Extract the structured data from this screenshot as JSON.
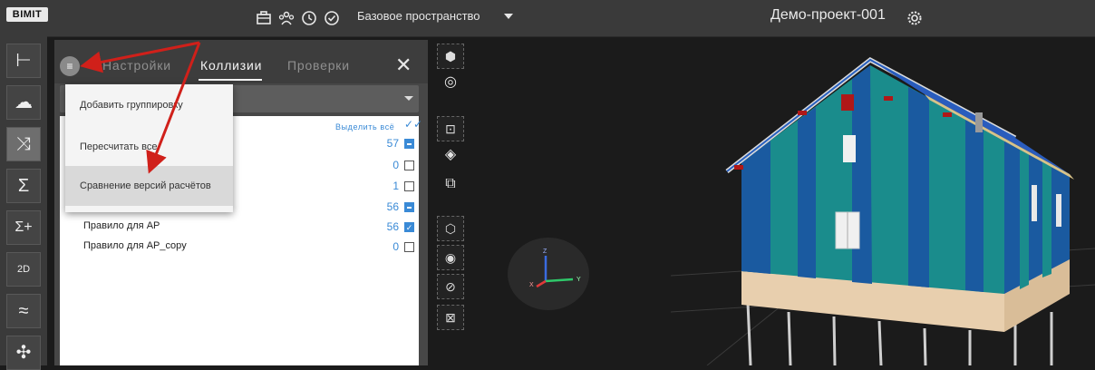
{
  "app": {
    "logo": "BIMIT"
  },
  "topbar": {
    "space_label": "Базовое пространство",
    "project_name": "Демо-проект-001",
    "icons": [
      "briefcase-icon",
      "users-icon",
      "clock-icon",
      "check-circle-icon",
      "settings-gear-icon"
    ]
  },
  "sidebar": {
    "items": [
      {
        "icon": "tree-icon",
        "glyph": "⊢"
      },
      {
        "icon": "cloud-sync-icon",
        "glyph": "☁"
      },
      {
        "icon": "shuffle-icon",
        "glyph": "⤨"
      },
      {
        "icon": "sigma-icon",
        "glyph": "Σ"
      },
      {
        "icon": "sigma-plus-icon",
        "glyph": "Σ+"
      },
      {
        "icon": "drawing-2d-icon",
        "glyph": "2D"
      },
      {
        "icon": "chart-line-icon",
        "glyph": "≈"
      },
      {
        "icon": "puzzle-icon",
        "glyph": "✣"
      }
    ]
  },
  "panel": {
    "tabs": [
      "Настройки",
      "Коллизии",
      "Проверки"
    ],
    "active_tab": "Коллизии",
    "select_all": "Выделить всё",
    "rows": [
      {
        "count": "57",
        "state": "partial"
      },
      {
        "count": "0",
        "state": "empty"
      },
      {
        "count": "1",
        "state": "empty"
      },
      {
        "count": "56",
        "state": "partial"
      },
      {
        "label": "Правило для АР",
        "count": "56",
        "state": "checked"
      },
      {
        "label": "Правило для АР_copy",
        "count": "0",
        "state": "empty"
      }
    ]
  },
  "popup_menu": {
    "items": [
      "Добавить группировку",
      "Пересчитать все",
      "Сравнение версий расчётов"
    ],
    "highlighted": "Сравнение версий расчётов"
  },
  "axes": {
    "z": "Z",
    "x": "X",
    "y": "Y"
  },
  "colors": {
    "accent": "#3a8ad6",
    "annotation_arrow": "#d0201a"
  }
}
